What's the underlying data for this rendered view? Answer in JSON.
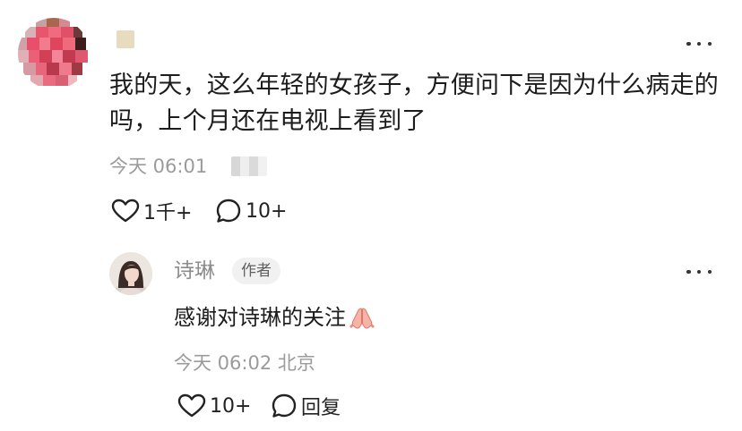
{
  "comment": {
    "text": "我的天，这么年轻的女孩子，方便问下是因为什么病走的吗，上个月还在电视上看到了",
    "time": "今天 06:01",
    "likes": "1千+",
    "replies": "10+"
  },
  "reply": {
    "author": "诗琳",
    "badge": "作者",
    "text": "感谢对诗琳的关注",
    "time_location": "今天 06:02 北京",
    "likes": "10+",
    "reply_label": "回复"
  },
  "colors": {
    "text": "#1c1c1c",
    "meta": "#9b9b9b",
    "badge_bg": "#f1f1f1"
  },
  "icons": [
    "more-icon",
    "heart-icon",
    "comment-bubble-icon",
    "praying-hands-icon"
  ]
}
